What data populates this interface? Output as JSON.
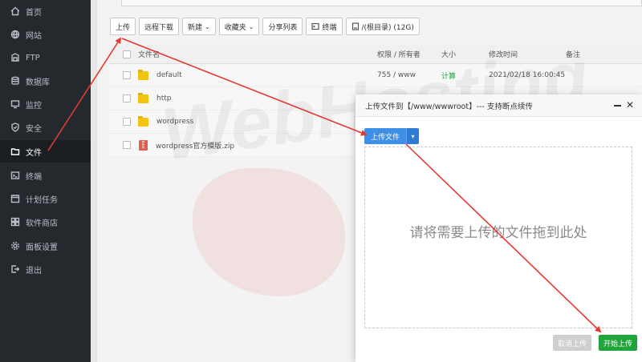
{
  "sidebar": {
    "items": [
      {
        "label": "首页",
        "icon": "home-icon",
        "active": false
      },
      {
        "label": "网站",
        "icon": "globe-icon",
        "active": false
      },
      {
        "label": "FTP",
        "icon": "ftp-icon",
        "active": false
      },
      {
        "label": "数据库",
        "icon": "database-icon",
        "active": false
      },
      {
        "label": "监控",
        "icon": "monitor-icon",
        "active": false
      },
      {
        "label": "安全",
        "icon": "shield-icon",
        "active": false
      },
      {
        "label": "文件",
        "icon": "folder-icon",
        "active": true
      },
      {
        "label": "终端",
        "icon": "terminal-icon",
        "active": false
      },
      {
        "label": "计划任务",
        "icon": "clock-icon",
        "active": false
      },
      {
        "label": "软件商店",
        "icon": "apps-icon",
        "active": false
      },
      {
        "label": "面板设置",
        "icon": "gear-icon",
        "active": false
      },
      {
        "label": "退出",
        "icon": "logout-icon",
        "active": false
      }
    ]
  },
  "toolbar": {
    "upload": "上传",
    "remote_download": "远程下载",
    "new": "新建",
    "favorites": "收藏夹",
    "share_list": "分享列表",
    "terminal": "终端",
    "disk": "/(根目录) (12G)"
  },
  "table": {
    "headers": {
      "name": "文件名",
      "perm": "权限 / 所有者",
      "size": "大小",
      "time": "修改时间",
      "note": "备注"
    },
    "rows": [
      {
        "name": "default",
        "type": "folder",
        "perm": "755 / www",
        "size": "计算",
        "time": "2021/02/18 16:00:45"
      },
      {
        "name": "http",
        "type": "folder",
        "perm": "",
        "size": "",
        "time": ""
      },
      {
        "name": "wordpress",
        "type": "folder",
        "perm": "",
        "size": "",
        "time": ""
      },
      {
        "name": "wordpress官方模版.zip",
        "type": "zip",
        "perm": "",
        "size": "",
        "time": ""
      }
    ]
  },
  "watermark": {
    "text": "WebHosting",
    "lang": "中文"
  },
  "modal": {
    "title": "上传文件到【/www/wwwroot】--- 支持断点续传",
    "upload_btn": "上传文件",
    "dropzone_text": "请将需要上传的文件拖到此处",
    "cancel": "取消上传",
    "start": "开始上传"
  },
  "colors": {
    "sidebar_bg": "#24292e",
    "accent_blue": "#3d8fe8",
    "accent_green": "#20a53a",
    "arrow_red": "#e53935"
  }
}
